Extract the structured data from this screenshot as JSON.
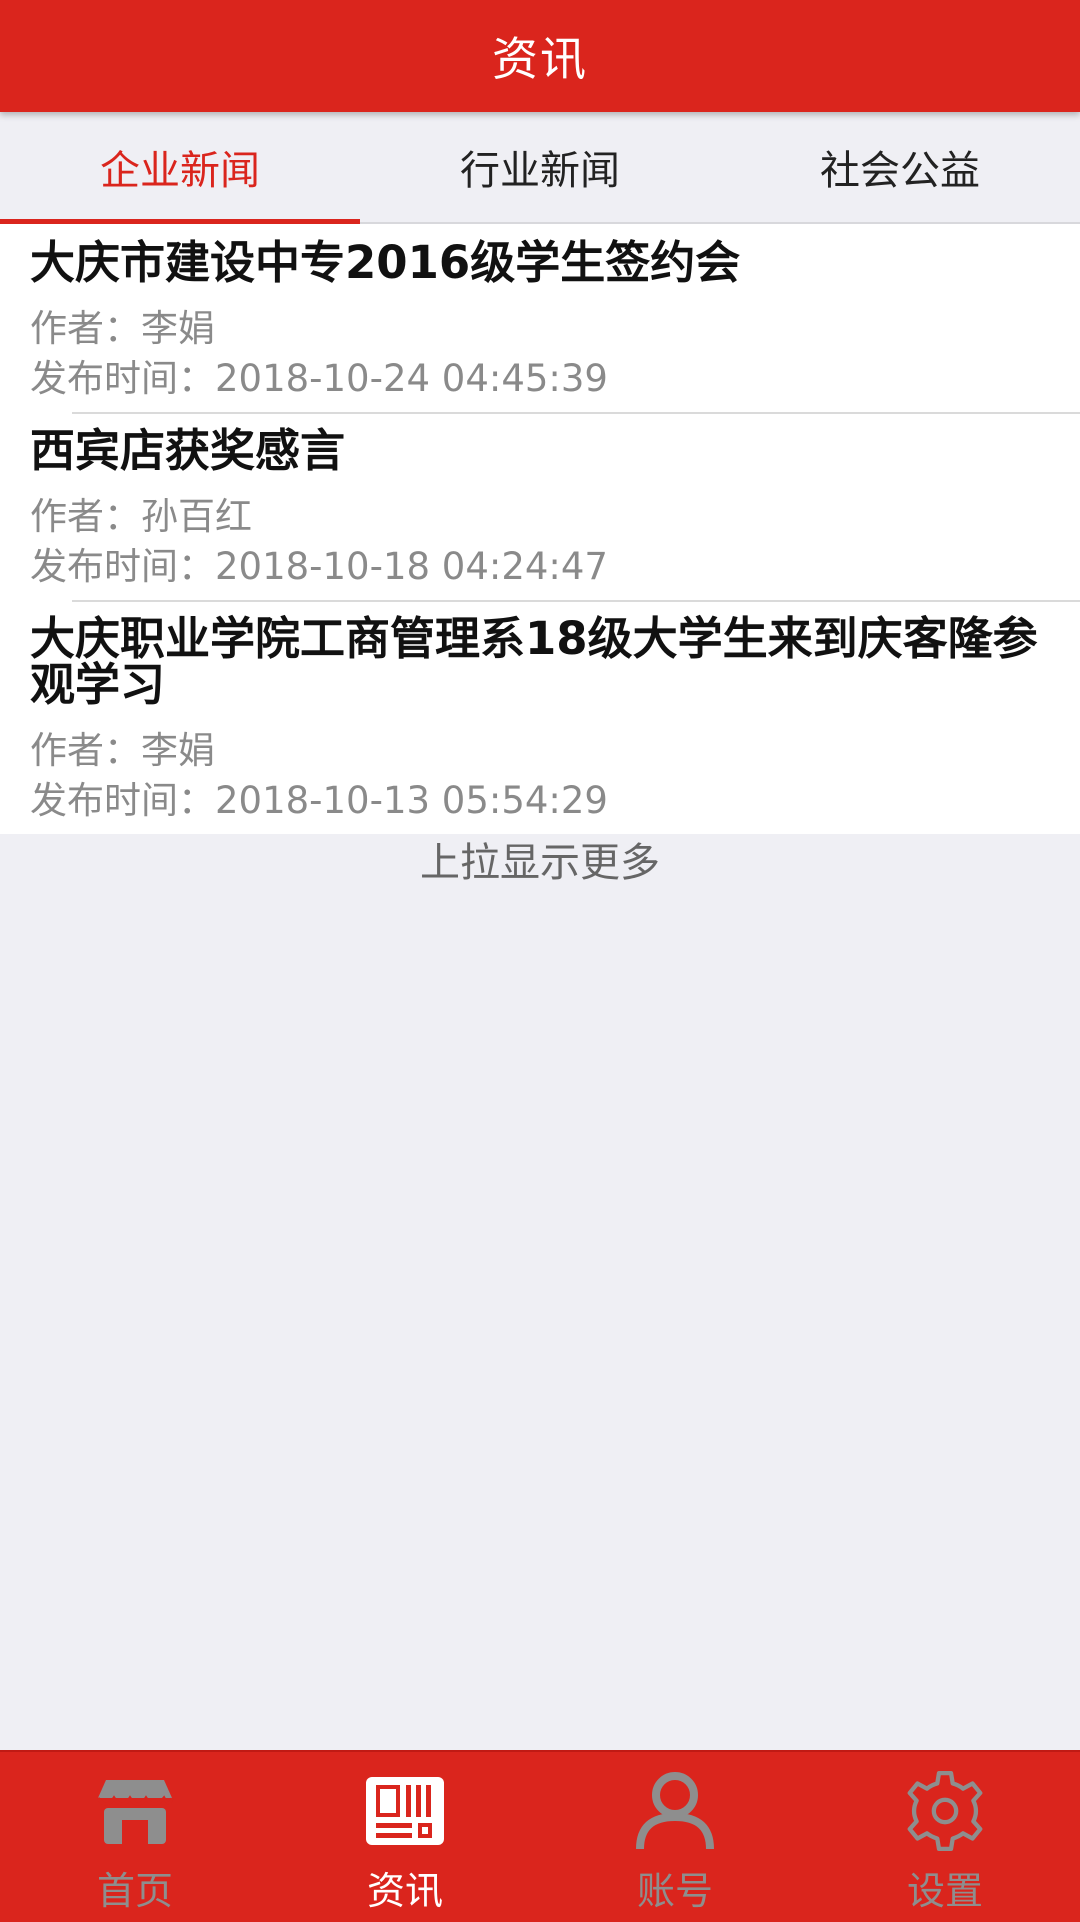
{
  "header": {
    "title": "资讯"
  },
  "tabs": [
    {
      "label": "企业新闻",
      "active": true
    },
    {
      "label": "行业新闻",
      "active": false
    },
    {
      "label": "社会公益",
      "active": false
    }
  ],
  "news": [
    {
      "title": "大庆市建设中专2016级学生签约会",
      "author": "作者：李娟",
      "time": "发布时间：2018-10-24 04:45:39"
    },
    {
      "title": "西宾店获奖感言",
      "author": "作者：孙百红",
      "time": "发布时间：2018-10-18 04:24:47"
    },
    {
      "title": "大庆职业学院工商管理系18级大学生来到庆客隆参观学习",
      "author": "作者：李娟",
      "time": "发布时间：2018-10-13 05:54:29"
    }
  ],
  "load_more": "上拉显示更多",
  "bottom_nav": [
    {
      "label": "首页",
      "icon": "store-icon",
      "active": false
    },
    {
      "label": "资讯",
      "icon": "newspaper-icon",
      "active": true
    },
    {
      "label": "账号",
      "icon": "user-icon",
      "active": false
    },
    {
      "label": "设置",
      "icon": "gear-icon",
      "active": false
    }
  ],
  "colors": {
    "brand_red": "#da251d",
    "inactive_gray": "#8e8e8e",
    "background": "#efeff4"
  }
}
